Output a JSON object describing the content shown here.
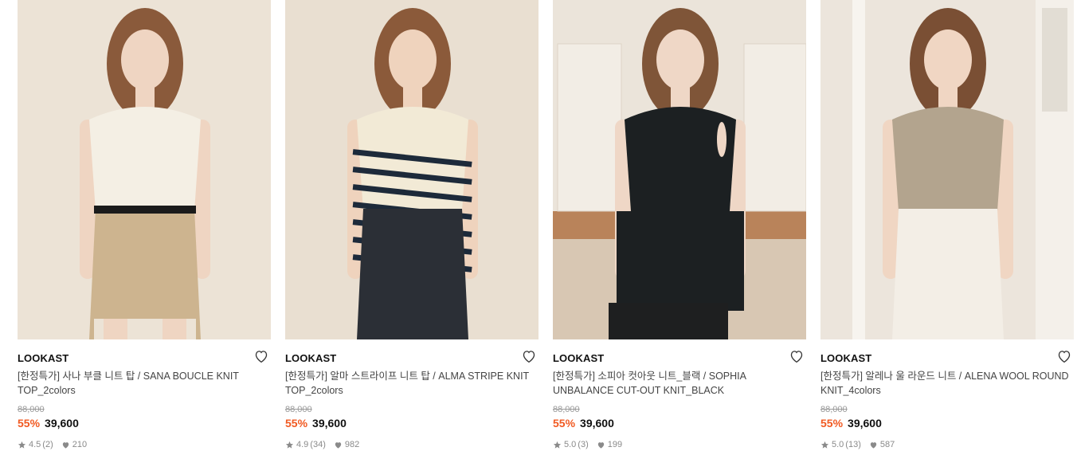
{
  "products": [
    {
      "brand": "LOOKAST",
      "title": "[한정특가] 사나 부클 니트 탑 / SANA BOUCLE KNIT TOP_2colors",
      "original_price": "88,000",
      "discount": "55%",
      "price": "39,600",
      "rating": "4.5",
      "review_count": "(2)",
      "likes": "210",
      "image": "woman-white-boucle-knit-beige-shorts",
      "colors": {
        "bg": "#ece3d6",
        "top": "#f4efe4",
        "bottom": "#cdb48f",
        "hair": "#8a5a3b",
        "skin": "#efd5c2"
      }
    },
    {
      "brand": "LOOKAST",
      "title": "[한정특가] 알마 스트라이프 니트 탑 / ALMA STRIPE KNIT TOP_2colors",
      "original_price": "88,000",
      "discount": "55%",
      "price": "39,600",
      "rating": "4.9",
      "review_count": "(34)",
      "likes": "982",
      "image": "woman-navy-stripe-knit-denim",
      "colors": {
        "bg": "#e9dfd1",
        "top": "#f2ead6",
        "bottom": "#2b2f36",
        "hair": "#8b5a3a",
        "skin": "#efd3bd"
      }
    },
    {
      "brand": "LOOKAST",
      "title": "[한정특가] 소피아 컷아웃 니트_블랙 / SOPHIA UNBALANCE CUT-OUT KNIT_BLACK",
      "original_price": "88,000",
      "discount": "55%",
      "price": "39,600",
      "rating": "5.0",
      "review_count": "(3)",
      "likes": "199",
      "image": "woman-black-cutout-knit-seated",
      "colors": {
        "bg": "#e6ddd2",
        "top": "#1c2022",
        "bottom": "#1e1f20",
        "hair": "#7f5538",
        "skin": "#efd7c6"
      }
    },
    {
      "brand": "LOOKAST",
      "title": "[한정특가] 알레나 울 라운드 니트 / ALENA WOOL ROUND KNIT_4colors",
      "original_price": "88,000",
      "discount": "55%",
      "price": "39,600",
      "rating": "5.0",
      "review_count": "(13)",
      "likes": "587",
      "image": "woman-oatmeal-wool-knit-white-trousers",
      "colors": {
        "bg": "#ece5dc",
        "top": "#b3a48e",
        "bottom": "#f3eee6",
        "hair": "#7a4f34",
        "skin": "#f0d6c3"
      }
    }
  ],
  "icons": {
    "wishlist": "heart-outline-icon",
    "rating": "star-icon",
    "likes": "heart-filled-icon"
  },
  "accent_color": "#f15a22"
}
